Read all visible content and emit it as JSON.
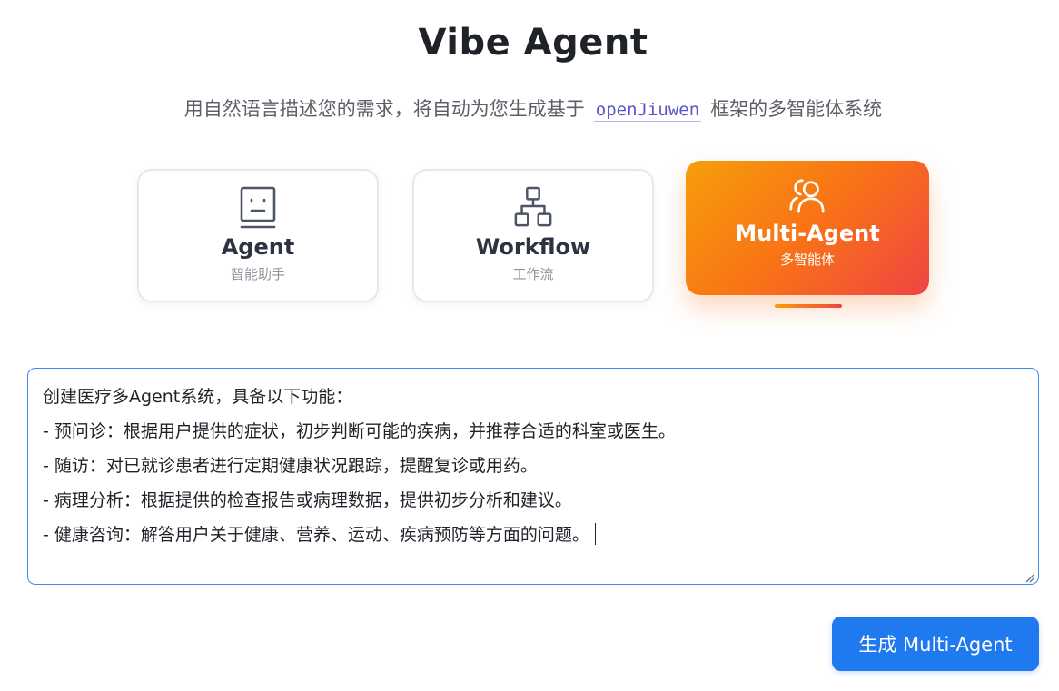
{
  "header": {
    "title": "Vibe Agent",
    "subtitle_before": "用自然语言描述您的需求，将自动为您生成基于",
    "framework": "openJiuwen",
    "subtitle_after": "框架的多智能体系统"
  },
  "modes": [
    {
      "name": "Agent",
      "desc": "智能助手",
      "icon": "robot-face-icon",
      "selected": false
    },
    {
      "name": "Workflow",
      "desc": "工作流",
      "icon": "workflow-tree-icon",
      "selected": false
    },
    {
      "name": "Multi-Agent",
      "desc": "多智能体",
      "icon": "users-icon",
      "selected": true
    }
  ],
  "editor": {
    "lines": [
      "创建医疗多Agent系统，具备以下功能：",
      "- 预问诊：根据用户提供的症状，初步判断可能的疾病，并推荐合适的科室或医生。",
      "- 随访：对已就诊患者进行定期健康状况跟踪，提醒复诊或用药。",
      "- 病理分析：根据提供的检查报告或病理数据，提供初步分析和建议。",
      "- 健康咨询：解答用户关于健康、营养、运动、疾病预防等方面的问题。"
    ]
  },
  "generate_button": {
    "label": "生成 Multi-Agent"
  },
  "colors": {
    "accent_blue": "#1f7af0",
    "selected_gradient_start": "#f59e0b",
    "selected_gradient_end": "#ef4444",
    "framework_text": "#5a55c9"
  }
}
